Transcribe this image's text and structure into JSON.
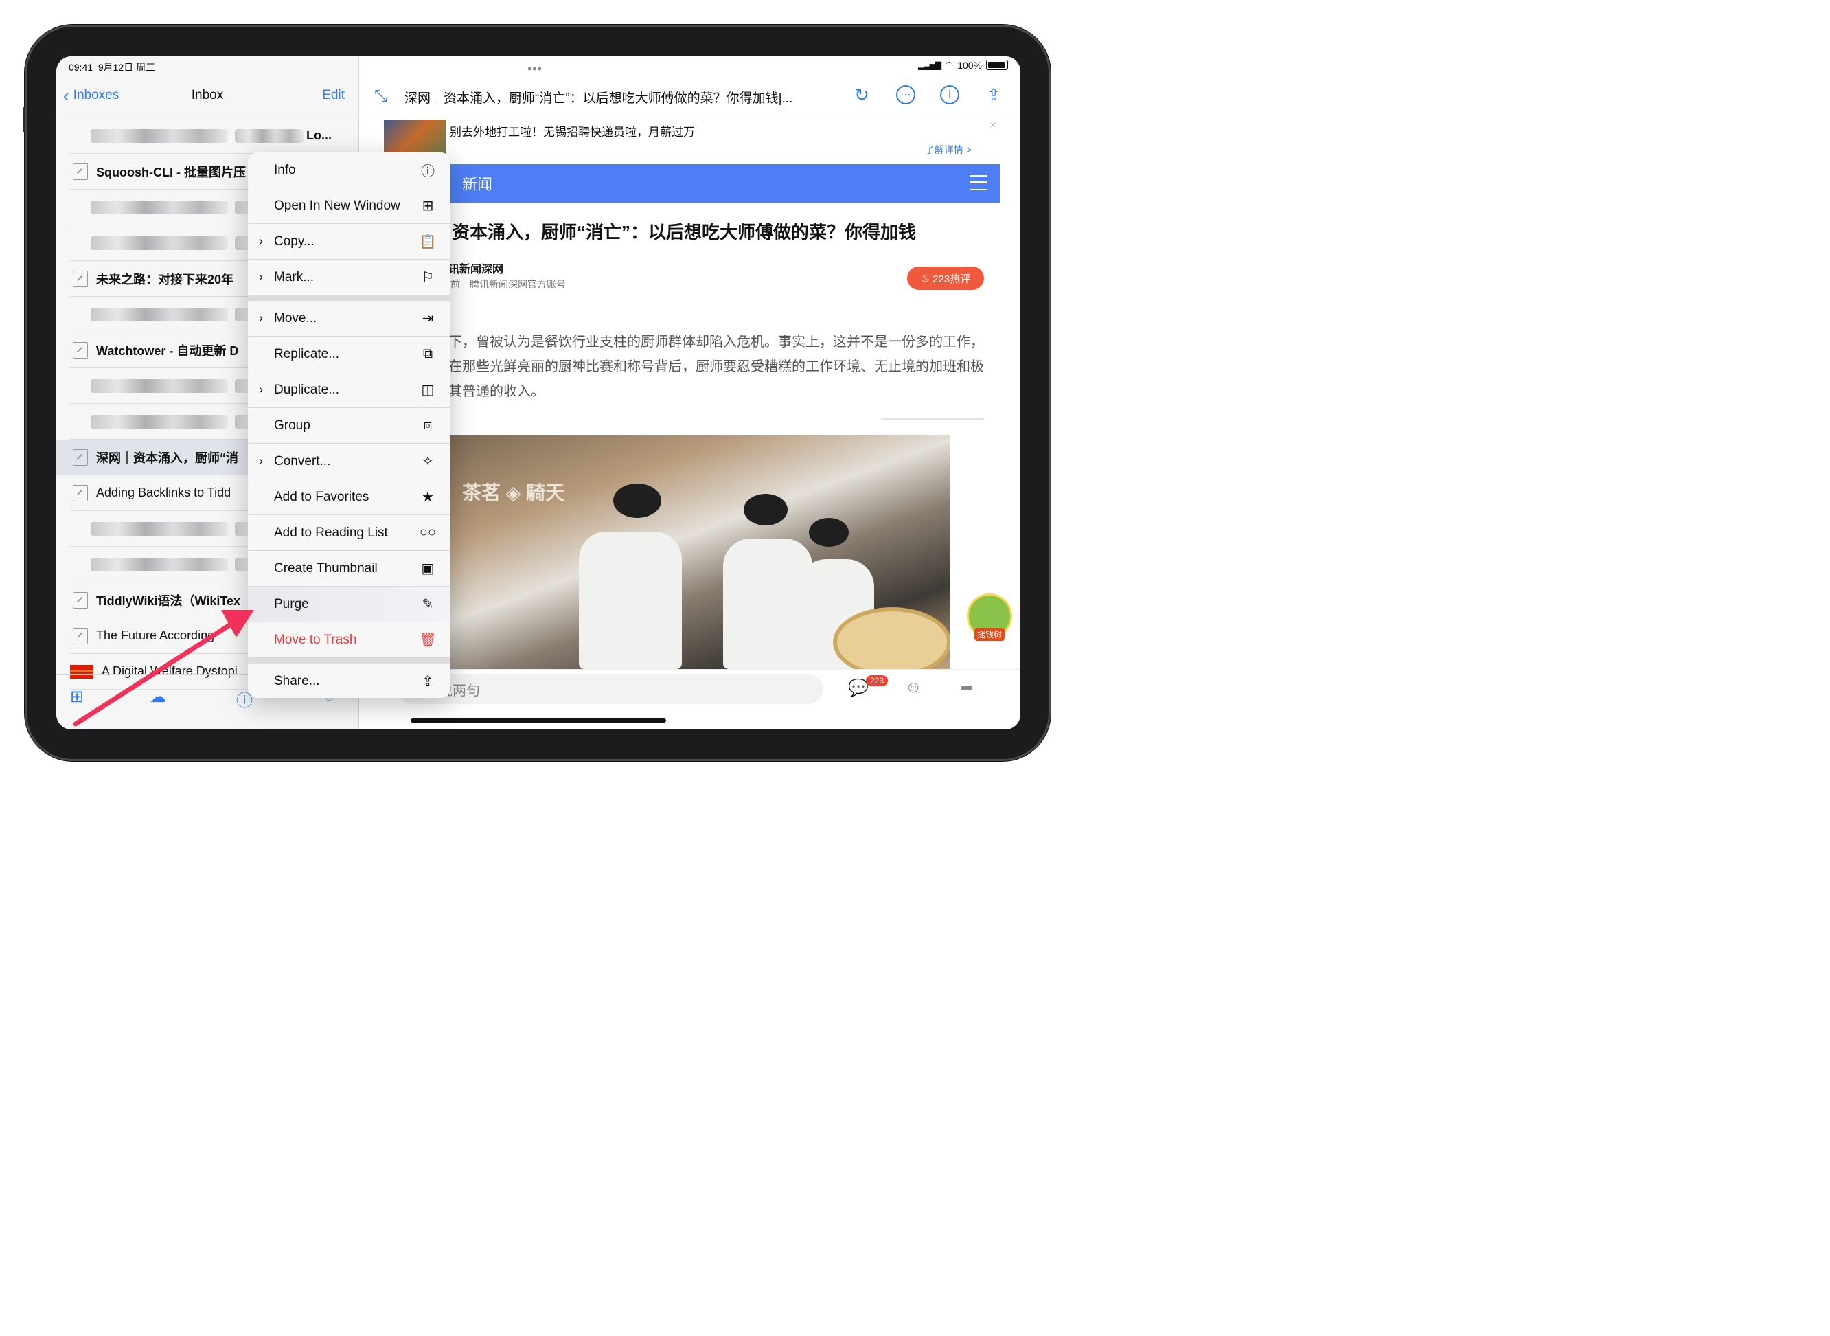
{
  "status": {
    "time": "09:41",
    "date": "9月12日 周三",
    "battery": "100%"
  },
  "left_nav": {
    "back": "Inboxes",
    "title": "Inbox",
    "edit": "Edit"
  },
  "list": [
    {
      "type": "blur",
      "text": "Lo..."
    },
    {
      "type": "doc",
      "bold": true,
      "text": "Squoosh-CLI - 批量图片压"
    },
    {
      "type": "blur",
      "text": "码"
    },
    {
      "type": "blur",
      "text": ""
    },
    {
      "type": "doc",
      "bold": true,
      "text": "未来之路：对接下来20年"
    },
    {
      "type": "blur",
      "text": ""
    },
    {
      "type": "doc",
      "bold": true,
      "text": "Watchtower - 自动更新 D"
    },
    {
      "type": "blur",
      "text": ""
    },
    {
      "type": "blur",
      "text": "eb服"
    },
    {
      "type": "doc",
      "bold": true,
      "selected": true,
      "text": "深网｜资本涌入，厨师“消"
    },
    {
      "type": "doc",
      "bold": false,
      "text": "Adding Backlinks to Tidd"
    },
    {
      "type": "blur",
      "text": ""
    },
    {
      "type": "blur",
      "text": "议"
    },
    {
      "type": "doc",
      "bold": true,
      "text": "TiddlyWiki语法（WikiTex"
    },
    {
      "type": "doc",
      "bold": false,
      "text": "The Future According"
    },
    {
      "type": "flag",
      "bold": false,
      "text": "A Digital Welfare Dystopi"
    }
  ],
  "right_nav": {
    "title": "深网｜资本涌入，厨师“消亡”：以后想吃大师傅做的菜？你得加钱|..."
  },
  "ad": {
    "text": "别去外地打工啦！无锡招聘快递员啦，月薪过万",
    "more": "了解详情 >",
    "close": "×"
  },
  "news_bar": {
    "label": "新闻"
  },
  "article": {
    "headline": "资本涌入，厨师“消亡”：以后想吃大师傅做的菜？你得加钱",
    "source": "讯新闻深网",
    "meta": "前　腾讯新闻深网官方账号",
    "hot": "223热评",
    "para": "下，曾被认为是餐饮行业支柱的厨师群体却陷入危机。事实上，这并不是一份多的工作，在那些光鲜亮丽的厨神比赛和称号背后，厨师要忍受糟糕的工作环境、无止境的加班和极其普通的收入。",
    "photo_sign": "茶茗 ◈ 騎天",
    "tree_label": "摇钱树"
  },
  "comment_bar": {
    "placeholder": "说两句",
    "count": "223"
  },
  "context_menu": {
    "items": [
      {
        "name": "info",
        "label": "Info",
        "chevron": false,
        "icon": "ⓘ",
        "icon_name": "info-icon"
      },
      {
        "name": "open-new-window",
        "label": "Open In New Window",
        "chevron": false,
        "icon": "⊞",
        "icon_name": "new-window-icon"
      },
      {
        "name": "copy",
        "label": "Copy...",
        "chevron": true,
        "icon": "📋",
        "icon_name": "clipboard-icon"
      },
      {
        "name": "mark",
        "label": "Mark...",
        "chevron": true,
        "icon": "⚐",
        "icon_name": "flag-icon"
      },
      {
        "sep": true
      },
      {
        "name": "move",
        "label": "Move...",
        "chevron": true,
        "icon": "⇥",
        "icon_name": "move-icon"
      },
      {
        "name": "replicate",
        "label": "Replicate...",
        "chevron": false,
        "icon": "⧉",
        "icon_name": "replicate-icon"
      },
      {
        "name": "duplicate",
        "label": "Duplicate...",
        "chevron": true,
        "icon": "◫",
        "icon_name": "duplicate-icon"
      },
      {
        "name": "group",
        "label": "Group",
        "chevron": false,
        "icon": "⧈",
        "icon_name": "group-icon"
      },
      {
        "name": "convert",
        "label": "Convert...",
        "chevron": true,
        "icon": "✧",
        "icon_name": "magic-wand-icon"
      },
      {
        "name": "add-favorites",
        "label": "Add to Favorites",
        "chevron": false,
        "icon": "★",
        "icon_name": "star-icon"
      },
      {
        "name": "add-reading-list",
        "label": "Add to Reading List",
        "chevron": false,
        "icon": "○○",
        "icon_name": "glasses-icon"
      },
      {
        "name": "create-thumbnail",
        "label": "Create Thumbnail",
        "chevron": false,
        "icon": "▣",
        "icon_name": "image-icon"
      },
      {
        "name": "purge",
        "label": "Purge",
        "chevron": false,
        "icon": "✎",
        "icon_name": "broom-icon",
        "highlight": true
      },
      {
        "name": "move-to-trash",
        "label": "Move to Trash",
        "chevron": false,
        "icon": "🗑",
        "icon_name": "trash-icon",
        "danger": true
      },
      {
        "sep": true
      },
      {
        "name": "share",
        "label": "Share...",
        "chevron": false,
        "icon": "⇪",
        "icon_name": "share-icon"
      }
    ]
  },
  "colors": {
    "accent": "#2f7df6",
    "danger": "#ec3b3b",
    "arrow": "#f0325a",
    "news_bar": "#4d7ef5"
  }
}
